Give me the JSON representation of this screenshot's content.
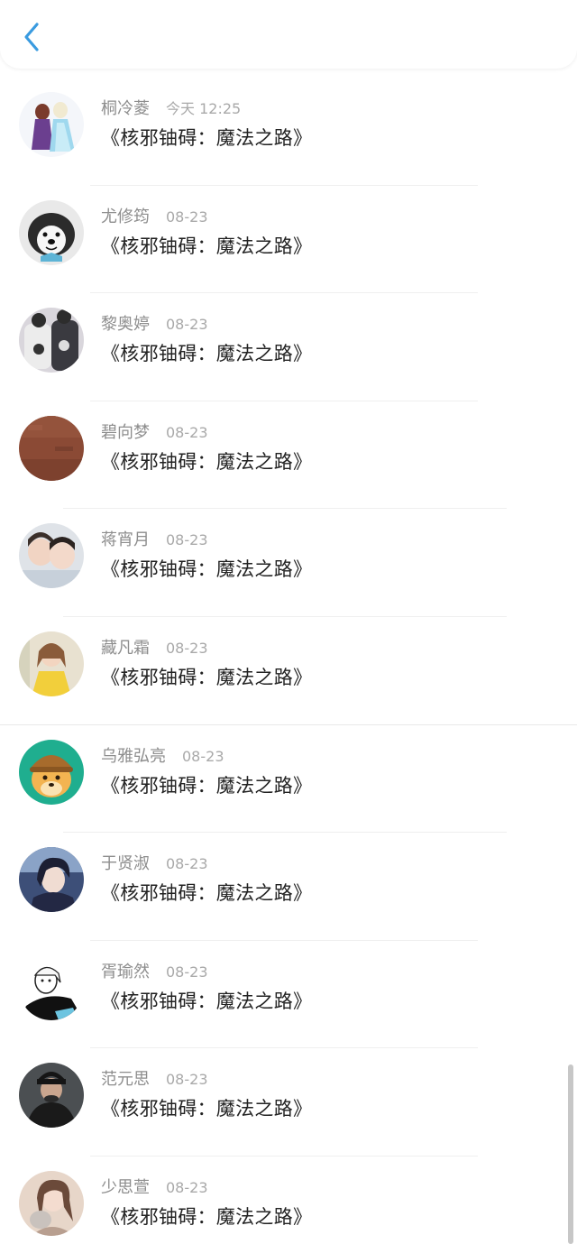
{
  "header": {
    "back_icon": "chevron-left-icon",
    "accent": "#3a9be0"
  },
  "messages": [
    {
      "name": "桐冷菱",
      "time": "今天 12:25",
      "text": "《核邪铀碍：魔法之路》"
    },
    {
      "name": "尤修筠",
      "time": "08-23",
      "text": "《核邪铀碍：魔法之路》"
    },
    {
      "name": "黎奥婷",
      "time": "08-23",
      "text": "《核邪铀碍：魔法之路》"
    },
    {
      "name": "碧向梦",
      "time": "08-23",
      "text": "《核邪铀碍：魔法之路》"
    },
    {
      "name": "蒋宵月",
      "time": "08-23",
      "text": "《核邪铀碍：魔法之路》"
    },
    {
      "name": "藏凡霜",
      "time": "08-23",
      "text": "《核邪铀碍：魔法之路》"
    },
    {
      "name": "乌雅弘亮",
      "time": "08-23",
      "text": "《核邪铀碍：魔法之路》"
    },
    {
      "name": "于贤淑",
      "time": "08-23",
      "text": "《核邪铀碍：魔法之路》"
    },
    {
      "name": "胥瑜然",
      "time": "08-23",
      "text": "《核邪铀碍：魔法之路》"
    },
    {
      "name": "范元思",
      "time": "08-23",
      "text": "《核邪铀碍：魔法之路》"
    },
    {
      "name": "少思萱",
      "time": "08-23",
      "text": "《核邪铀碍：魔法之路》"
    }
  ]
}
